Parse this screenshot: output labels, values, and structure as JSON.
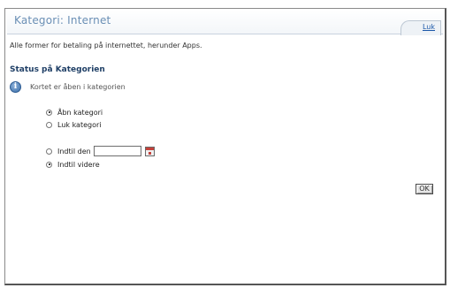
{
  "header": {
    "title": "Kategori: Internet",
    "close_label": "Luk"
  },
  "description": "Alle former for betaling på internettet, herunder Apps.",
  "status": {
    "heading": "Status på Kategorien",
    "info_text": "Kortet er åben i kategorien",
    "info_icon": "info-icon"
  },
  "state_options": [
    {
      "label": "Åbn kategori",
      "checked": true
    },
    {
      "label": "Luk kategori",
      "checked": false
    }
  ],
  "duration_options": [
    {
      "label": "Indtil den",
      "checked": false
    },
    {
      "label": "Indtil videre",
      "checked": true
    }
  ],
  "date_field": {
    "value": "",
    "calendar_icon": "calendar-icon"
  },
  "ok_label": "OK"
}
